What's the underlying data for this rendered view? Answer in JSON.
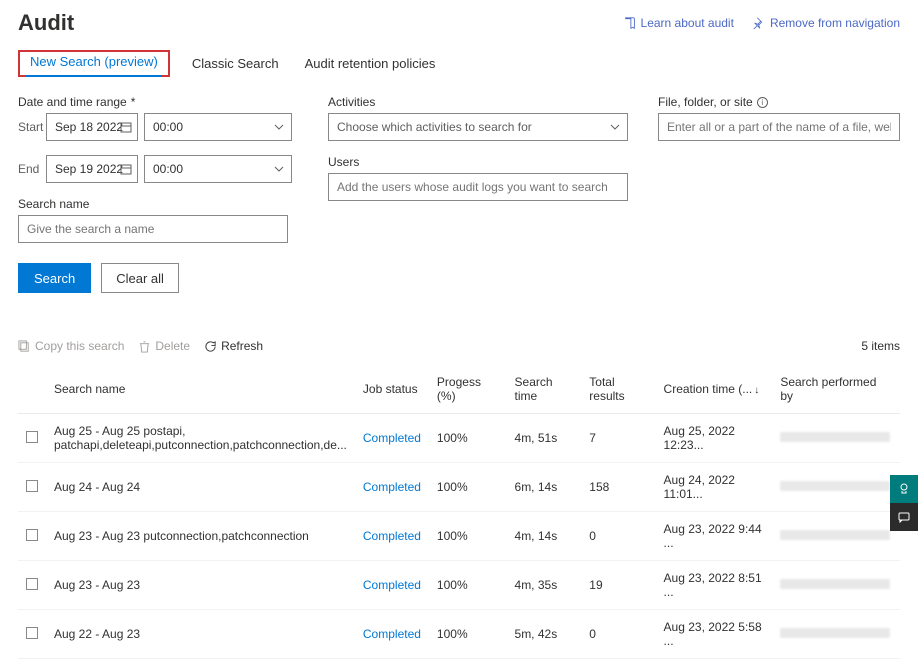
{
  "header": {
    "title": "Audit",
    "links": {
      "learn": "Learn about audit",
      "remove": "Remove from navigation"
    }
  },
  "tabs": {
    "new_search": "New Search (preview)",
    "classic": "Classic Search",
    "retention": "Audit retention policies"
  },
  "form": {
    "date_label": "Date and time range",
    "start_label": "Start",
    "end_label": "End",
    "start_date": "Sep 18 2022",
    "end_date": "Sep 19 2022",
    "start_time": "00:00",
    "end_time": "00:00",
    "search_name_label": "Search name",
    "search_name_placeholder": "Give the search a name",
    "activities_label": "Activities",
    "activities_placeholder": "Choose which activities to search for",
    "users_label": "Users",
    "users_placeholder": "Add the users whose audit logs you want to search",
    "file_label": "File, folder, or site",
    "file_placeholder": "Enter all or a part of the name of a file, website, or folder",
    "search_btn": "Search",
    "clear_btn": "Clear all"
  },
  "toolbar": {
    "copy": "Copy this search",
    "delete": "Delete",
    "refresh": "Refresh",
    "count": "5 items"
  },
  "table": {
    "cols": {
      "name": "Search name",
      "status": "Job status",
      "progress": "Progess (%)",
      "time": "Search time",
      "results": "Total results",
      "creation": "Creation time (...",
      "performer": "Search performed by"
    },
    "rows": [
      {
        "name": "Aug 25 - Aug 25 postapi, patchapi,deleteapi,putconnection,patchconnection,de...",
        "status": "Completed",
        "progress": "100%",
        "time": "4m, 51s",
        "results": "7",
        "creation": "Aug 25, 2022 12:23..."
      },
      {
        "name": "Aug 24 - Aug 24",
        "status": "Completed",
        "progress": "100%",
        "time": "6m, 14s",
        "results": "158",
        "creation": "Aug 24, 2022 11:01..."
      },
      {
        "name": "Aug 23 - Aug 23 putconnection,patchconnection",
        "status": "Completed",
        "progress": "100%",
        "time": "4m, 14s",
        "results": "0",
        "creation": "Aug 23, 2022 9:44 ..."
      },
      {
        "name": "Aug 23 - Aug 23",
        "status": "Completed",
        "progress": "100%",
        "time": "4m, 35s",
        "results": "19",
        "creation": "Aug 23, 2022 8:51 ..."
      },
      {
        "name": "Aug 22 - Aug 23",
        "status": "Completed",
        "progress": "100%",
        "time": "5m, 42s",
        "results": "0",
        "creation": "Aug 23, 2022 5:58 ..."
      }
    ]
  }
}
